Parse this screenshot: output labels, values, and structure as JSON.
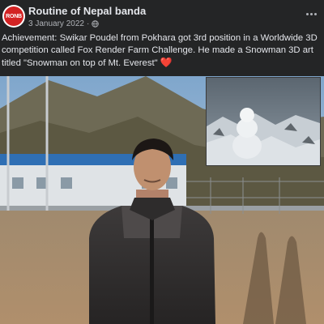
{
  "post": {
    "page_name": "Routine of Nepal banda",
    "avatar_text": "RONB",
    "date": "3 January 2022",
    "audience_icon": "globe-icon",
    "more_icon": "more-horizontal-icon",
    "caption": "Achievement: Swikar Poudel from Pokhara got 3rd position in a Worldwide 3D competition called Fox Render Farm Challenge. He made a Snowman 3D art titled \"Snowman on top of Mt. Everest\"",
    "caption_emoji": "❤️",
    "date_separator": "·"
  },
  "colors": {
    "background": "#242526",
    "text": "#e4e6eb",
    "secondary_text": "#b0b3b8",
    "avatar_red": "#d32323",
    "heart": "#f33e58"
  }
}
